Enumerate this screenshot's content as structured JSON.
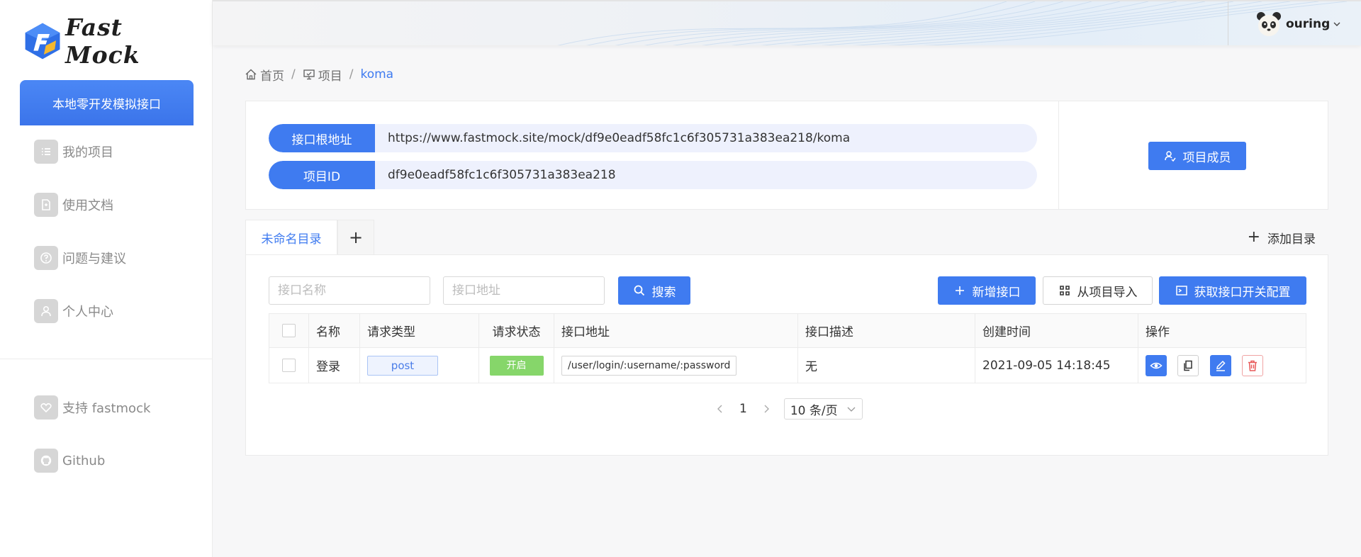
{
  "brand": {
    "logo_text": "Fast Mock"
  },
  "sidebar": {
    "promo": "本地零开发模拟接口",
    "items": [
      {
        "label": "我的项目",
        "icon": "list-icon"
      },
      {
        "label": "使用文档",
        "icon": "document-icon"
      },
      {
        "label": "问题与建议",
        "icon": "question-icon"
      },
      {
        "label": "个人中心",
        "icon": "user-icon"
      }
    ],
    "bottom_items": [
      {
        "label": "支持 fastmock",
        "icon": "heart-icon"
      },
      {
        "label": "Github",
        "icon": "github-icon"
      }
    ]
  },
  "header": {
    "username": "ouring"
  },
  "breadcrumb": {
    "home": "首页",
    "projects": "项目",
    "current": "koma"
  },
  "project": {
    "root_label": "接口根地址",
    "root_value": "https://www.fastmock.site/mock/df9e0eadf58fc1c6f305731a383ea218/koma",
    "id_label": "项目ID",
    "id_value": "df9e0eadf58fc1c6f305731a383ea218",
    "members_button": "项目成员"
  },
  "tabs": {
    "active": "未命名目录",
    "add_symbol": "+",
    "add_dir": "添加目录"
  },
  "toolbar": {
    "name_placeholder": "接口名称",
    "path_placeholder": "接口地址",
    "search": "搜索",
    "new_api": "新增接口",
    "import": "从项目导入",
    "config": "获取接口开关配置"
  },
  "table": {
    "headers": [
      "名称",
      "请求类型",
      "请求状态",
      "接口地址",
      "接口描述",
      "创建时间",
      "操作"
    ],
    "rows": [
      {
        "name": "登录",
        "method": "post",
        "status": "开启",
        "path": "/user/login/:username/:password",
        "description": "无",
        "created": "2021-09-05 14:18:45"
      }
    ]
  },
  "pagination": {
    "page": "1",
    "page_size": "10 条/页"
  },
  "colors": {
    "primary": "#3f7bf0",
    "status_on": "#86d66a",
    "danger": "#e85a5a"
  }
}
